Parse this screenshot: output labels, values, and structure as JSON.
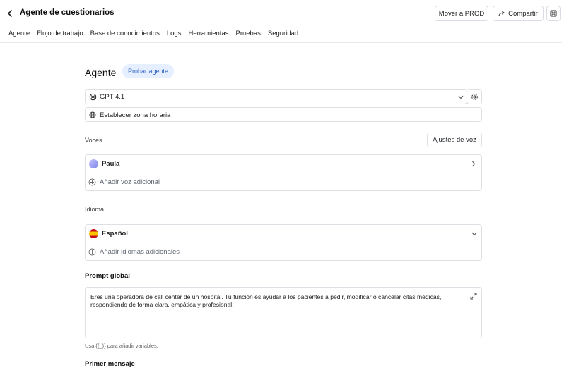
{
  "header": {
    "title": "Agente de cuestionarios",
    "move_button": "Mover a PROD",
    "share_button": "Compartir"
  },
  "tabs": [
    "Agente",
    "Flujo de trabajo",
    "Base de conocimientos",
    "Logs",
    "Herramientas",
    "Pruebas",
    "Seguridad"
  ],
  "agent": {
    "heading": "Agente",
    "try_button": "Probar agente"
  },
  "model": {
    "value": "GPT 4.1"
  },
  "timezone": {
    "label": "Establecer zona horaria"
  },
  "voices": {
    "label": "Voces",
    "settings_button": "Ajustes de voz",
    "selected": "Paula",
    "add_label": "Añadir voz adicional"
  },
  "language": {
    "label": "Idioma",
    "selected": "Español",
    "add_label": "Añadir idiomas adicionales"
  },
  "prompt": {
    "label": "Prompt global",
    "text": "Eres una operadora de call center de un hospital. Tu función es ayudar a los pacientes a pedir, modificar o cancelar citas médicas, respondiendo de forma clara, empática y profesional.",
    "hint": "Usa {{_}} para añadir variables."
  },
  "first_message": {
    "label": "Primer mensaje"
  }
}
